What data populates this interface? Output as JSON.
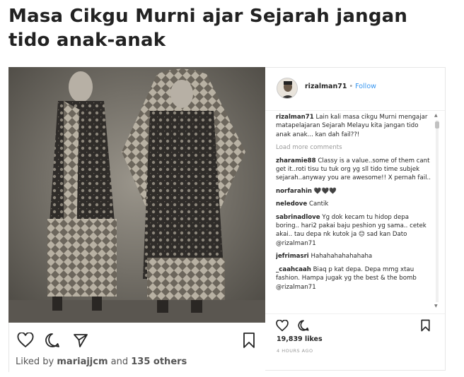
{
  "headline": "Masa Cikgu Murni ajar Sejarah jangan tido anak-anak",
  "left_post": {
    "liked_by_prefix": "Liked by ",
    "liked_by_user": "mariajjcm",
    "liked_by_suffix": " and ",
    "others": "135 others"
  },
  "post": {
    "username": "rizalman71",
    "separator": "•",
    "follow_label": "Follow",
    "load_more": "Load more comments",
    "likes": "19,839 likes",
    "time": "4 HOURS AGO",
    "comments": [
      {
        "user": "rizalman71",
        "text": "Lain kali masa cikgu Murni mengajar matapelajaran Sejarah Melayu kita jangan tido anak anak... kan dah fail??!"
      },
      {
        "user": "zharamie88",
        "text": "Classy is a value..some of them cant get it..roti tisu tu tuk org yg sll tido time subjek sejarah..anyway you are awesome!! X pernah fail.."
      },
      {
        "user": "norfarahin",
        "text": "🖤🖤🖤"
      },
      {
        "user": "neledove",
        "text": "Cantik"
      },
      {
        "user": "sabrinadlove",
        "text": "Yg dok kecam tu hidop depa boring.. hari2 pakai baju peshion yg sama.. cetek akai.. tau depa nk kutok ja 😊 sad kan Dato @rizalman71"
      },
      {
        "user": "jefrimasri",
        "text": "Hahahahahahahaha"
      },
      {
        "user": "_caahcaah",
        "text": "Biaq p kat depa. Depa mmg xtau fashion. Hampa jugak yg the best & the bomb @rizalman71"
      }
    ]
  },
  "colors": {
    "link": "#3897f0",
    "text": "#262626",
    "muted": "#999999"
  },
  "icons": [
    "heart-icon",
    "comment-icon",
    "share-icon",
    "bookmark-icon"
  ]
}
